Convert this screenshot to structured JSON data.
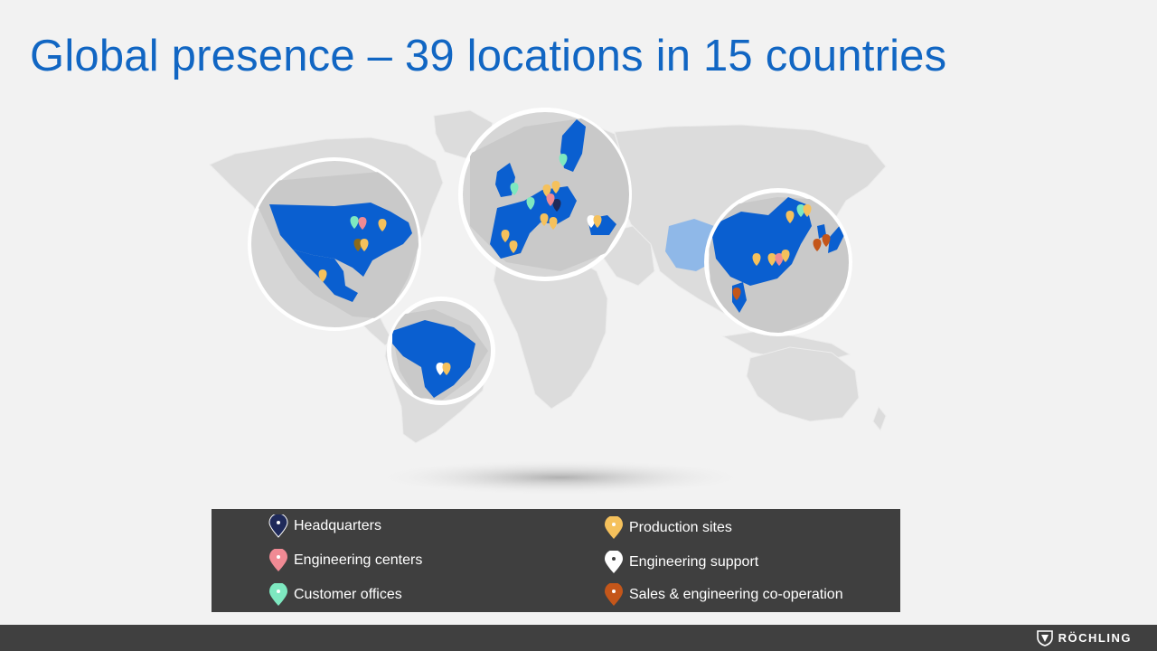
{
  "slide": {
    "title": "Global presence – 39 locations in 15 countries"
  },
  "legend": {
    "items": [
      {
        "key": "headquarters",
        "label": "Headquarters",
        "color": "#1f2a5a",
        "dot": "#ffffff"
      },
      {
        "key": "engineering_centers",
        "label": "Engineering centers",
        "color": "#f08a94",
        "dot": "#ffffff"
      },
      {
        "key": "customer_offices",
        "label": "Customer offices",
        "color": "#7ee8c0",
        "dot": "#ffffff"
      },
      {
        "key": "production_sites",
        "label": "Production sites",
        "color": "#f5c15c",
        "dot": "#ffffff"
      },
      {
        "key": "engineering_support",
        "label": "Engineering support",
        "color": "#ffffff",
        "dot": "#404040"
      },
      {
        "key": "sales_engineering",
        "label": "Sales & engineering co-operation",
        "color": "#c4561a",
        "dot": "#ffffff"
      }
    ]
  },
  "colors": {
    "title": "#1166c3",
    "highlighted_country": "#0a5fd0",
    "secondary_country": "#8fb8e8",
    "land": "#d9d9d9",
    "background": "#f2f2f2",
    "legend_bg": "#3f3f3f",
    "footer_bg": "#404040"
  },
  "footer": {
    "logo_text": "RÖCHLING",
    "logo_icon": "roechling-shield-icon"
  }
}
